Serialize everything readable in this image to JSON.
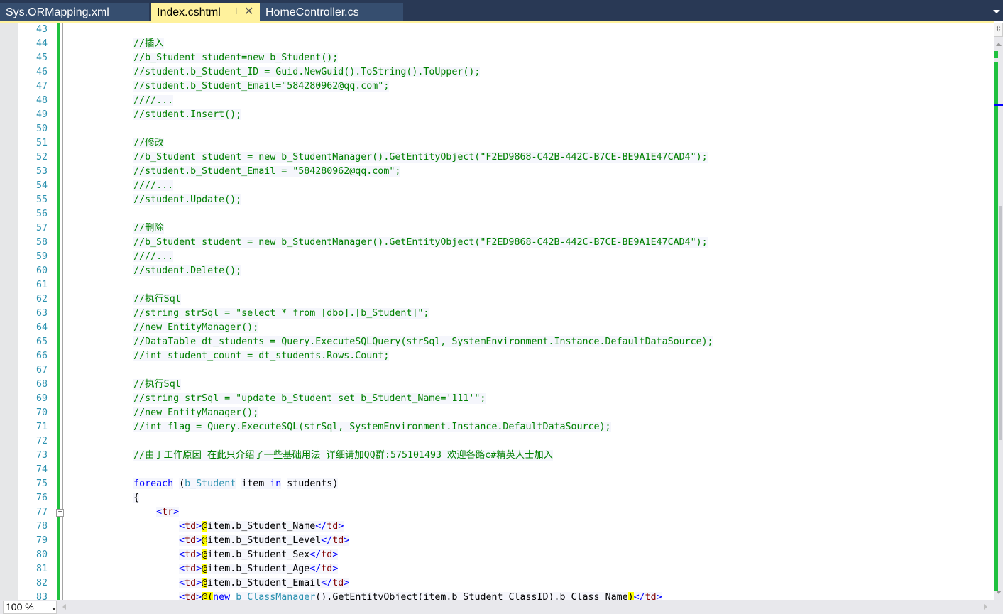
{
  "tabs": [
    {
      "label": "Sys.ORMapping.xml",
      "active": false
    },
    {
      "label": "Index.cshtml",
      "active": true,
      "pin_icon": "pin-icon",
      "close_icon": "close-icon"
    },
    {
      "label": "HomeController.cs",
      "active": false
    }
  ],
  "zoom_level": "100 %",
  "colors": {
    "comment": "#008000",
    "keyword": "#0000ff",
    "type": "#2b91af",
    "html_tag": "#800000",
    "razor_at": "#ffff00",
    "change_bar": "#1fc13f",
    "tab_active": "#fff29d",
    "tab_bar": "#293955"
  },
  "code_lines": [
    {
      "n": "43",
      "tokens": []
    },
    {
      "n": "44",
      "tokens": [
        [
          "c",
          "            //插入"
        ]
      ]
    },
    {
      "n": "45",
      "tokens": [
        [
          "c",
          "            //b_Student student=new b_Student();"
        ]
      ]
    },
    {
      "n": "46",
      "tokens": [
        [
          "c",
          "            //student.b_Student_ID = Guid.NewGuid().ToString().ToUpper();"
        ]
      ]
    },
    {
      "n": "47",
      "tokens": [
        [
          "c",
          "            //student.b_Student_Email=\"584280962@qq.com\";"
        ]
      ]
    },
    {
      "n": "48",
      "tokens": [
        [
          "c",
          "            ////..."
        ]
      ]
    },
    {
      "n": "49",
      "tokens": [
        [
          "c",
          "            //student.Insert();"
        ]
      ]
    },
    {
      "n": "50",
      "tokens": []
    },
    {
      "n": "51",
      "tokens": [
        [
          "c",
          "            //修改"
        ]
      ]
    },
    {
      "n": "52",
      "tokens": [
        [
          "c",
          "            //b_Student student = new b_StudentManager().GetEntityObject(\"F2ED9868-C42B-442C-B7CE-BE9A1E47CAD4\");"
        ]
      ]
    },
    {
      "n": "53",
      "tokens": [
        [
          "c",
          "            //student.b_Student_Email = \"584280962@qq.com\";"
        ]
      ]
    },
    {
      "n": "54",
      "tokens": [
        [
          "c",
          "            ////..."
        ]
      ]
    },
    {
      "n": "55",
      "tokens": [
        [
          "c",
          "            //student.Update();"
        ]
      ]
    },
    {
      "n": "56",
      "tokens": []
    },
    {
      "n": "57",
      "tokens": [
        [
          "c",
          "            //删除"
        ]
      ]
    },
    {
      "n": "58",
      "tokens": [
        [
          "c",
          "            //b_Student student = new b_StudentManager().GetEntityObject(\"F2ED9868-C42B-442C-B7CE-BE9A1E47CAD4\");"
        ]
      ]
    },
    {
      "n": "59",
      "tokens": [
        [
          "c",
          "            ////..."
        ]
      ]
    },
    {
      "n": "60",
      "tokens": [
        [
          "c",
          "            //student.Delete();"
        ]
      ]
    },
    {
      "n": "61",
      "tokens": []
    },
    {
      "n": "62",
      "tokens": [
        [
          "c",
          "            //执行Sql"
        ]
      ]
    },
    {
      "n": "63",
      "tokens": [
        [
          "c",
          "            //string strSql = \"select * from [dbo].[b_Student]\";"
        ]
      ]
    },
    {
      "n": "64",
      "tokens": [
        [
          "c",
          "            //new EntityManager();"
        ]
      ]
    },
    {
      "n": "65",
      "tokens": [
        [
          "c",
          "            //DataTable dt_students = Query.ExecuteSQLQuery(strSql, SystemEnvironment.Instance.DefaultDataSource);"
        ]
      ]
    },
    {
      "n": "66",
      "tokens": [
        [
          "c",
          "            //int student_count = dt_students.Rows.Count;"
        ]
      ]
    },
    {
      "n": "67",
      "tokens": []
    },
    {
      "n": "68",
      "tokens": [
        [
          "c",
          "            //执行Sql"
        ]
      ]
    },
    {
      "n": "69",
      "tokens": [
        [
          "c",
          "            //string strSql = \"update b_Student set b_Student_Name='111'\";"
        ]
      ]
    },
    {
      "n": "70",
      "tokens": [
        [
          "c",
          "            //new EntityManager();"
        ]
      ]
    },
    {
      "n": "71",
      "tokens": [
        [
          "c",
          "            //int flag = Query.ExecuteSQL(strSql, SystemEnvironment.Instance.DefaultDataSource);"
        ]
      ]
    },
    {
      "n": "72",
      "tokens": []
    },
    {
      "n": "73",
      "tokens": [
        [
          "c",
          "            //由于工作原因 在此只介绍了一些基础用法 详细请加QQ群:575101493 欢迎各路c#精英人士加入"
        ]
      ]
    },
    {
      "n": "74",
      "tokens": []
    },
    {
      "n": "75",
      "tokens": [
        [
          "p",
          "            "
        ],
        [
          "k",
          "foreach"
        ],
        [
          "p",
          " ("
        ],
        [
          "t",
          "b_Student"
        ],
        [
          "p",
          " item "
        ],
        [
          "k",
          "in"
        ],
        [
          "p",
          " students)"
        ]
      ]
    },
    {
      "n": "76",
      "tokens": [
        [
          "p",
          "            {"
        ]
      ]
    },
    {
      "n": "77",
      "fold": true,
      "tokens": [
        [
          "p",
          "                "
        ],
        [
          "b",
          "<"
        ],
        [
          "h",
          "tr"
        ],
        [
          "b",
          ">"
        ]
      ]
    },
    {
      "n": "78",
      "tokens": [
        [
          "p",
          "                    "
        ],
        [
          "b",
          "<"
        ],
        [
          "h",
          "td"
        ],
        [
          "b",
          ">"
        ],
        [
          "a",
          "@"
        ],
        [
          "p",
          "item.b_Student_Name"
        ],
        [
          "b",
          "</"
        ],
        [
          "h",
          "td"
        ],
        [
          "b",
          ">"
        ]
      ]
    },
    {
      "n": "79",
      "tokens": [
        [
          "p",
          "                    "
        ],
        [
          "b",
          "<"
        ],
        [
          "h",
          "td"
        ],
        [
          "b",
          ">"
        ],
        [
          "a",
          "@"
        ],
        [
          "p",
          "item.b_Student_Level"
        ],
        [
          "b",
          "</"
        ],
        [
          "h",
          "td"
        ],
        [
          "b",
          ">"
        ]
      ]
    },
    {
      "n": "80",
      "tokens": [
        [
          "p",
          "                    "
        ],
        [
          "b",
          "<"
        ],
        [
          "h",
          "td"
        ],
        [
          "b",
          ">"
        ],
        [
          "a",
          "@"
        ],
        [
          "p",
          "item.b_Student_Sex"
        ],
        [
          "b",
          "</"
        ],
        [
          "h",
          "td"
        ],
        [
          "b",
          ">"
        ]
      ]
    },
    {
      "n": "81",
      "tokens": [
        [
          "p",
          "                    "
        ],
        [
          "b",
          "<"
        ],
        [
          "h",
          "td"
        ],
        [
          "b",
          ">"
        ],
        [
          "a",
          "@"
        ],
        [
          "p",
          "item.b_Student_Age"
        ],
        [
          "b",
          "</"
        ],
        [
          "h",
          "td"
        ],
        [
          "b",
          ">"
        ]
      ]
    },
    {
      "n": "82",
      "tokens": [
        [
          "p",
          "                    "
        ],
        [
          "b",
          "<"
        ],
        [
          "h",
          "td"
        ],
        [
          "b",
          ">"
        ],
        [
          "a",
          "@"
        ],
        [
          "p",
          "item.b_Student_Email"
        ],
        [
          "b",
          "</"
        ],
        [
          "h",
          "td"
        ],
        [
          "b",
          ">"
        ]
      ]
    },
    {
      "n": "83",
      "tokens": [
        [
          "p",
          "                    "
        ],
        [
          "b",
          "<"
        ],
        [
          "h",
          "td"
        ],
        [
          "b",
          ">"
        ],
        [
          "a",
          "@("
        ],
        [
          "k",
          "new"
        ],
        [
          "p",
          " "
        ],
        [
          "t",
          "b_ClassManager"
        ],
        [
          "p",
          "().GetEntityObject(item.b_Student_ClassID).b_Class_Name"
        ],
        [
          "a",
          ")"
        ],
        [
          "b",
          "</"
        ],
        [
          "h",
          "td"
        ],
        [
          "b",
          ">"
        ]
      ]
    }
  ]
}
